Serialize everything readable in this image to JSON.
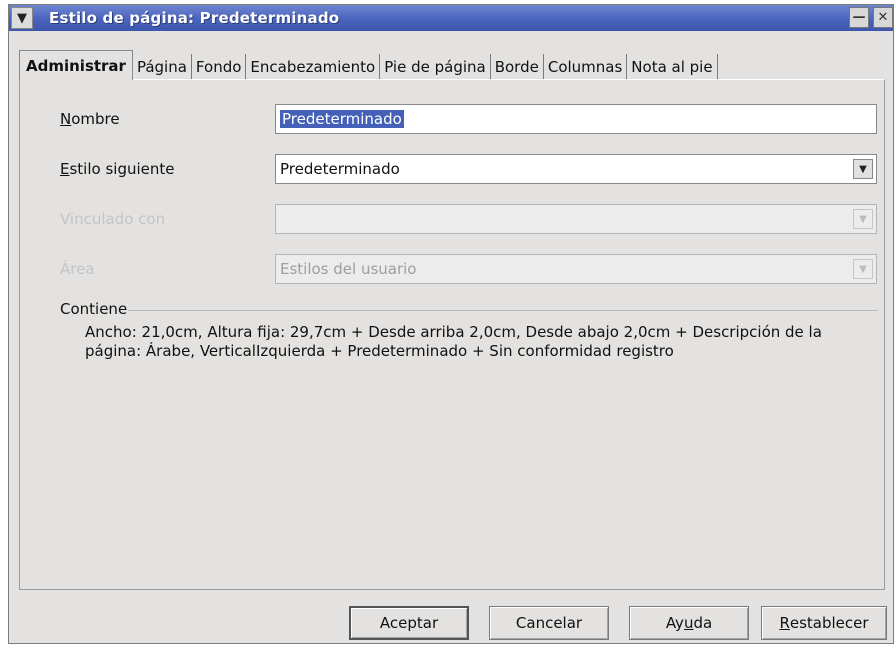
{
  "window": {
    "title": "Estilo de página: Predeterminado",
    "menu_icon": "chevron-down-icon",
    "minimize_icon": "minimize-icon",
    "close_icon": "close-icon"
  },
  "tabs": [
    {
      "label": "Administrar",
      "active": true
    },
    {
      "label": "Página",
      "active": false
    },
    {
      "label": "Fondo",
      "active": false
    },
    {
      "label": "Encabezamiento",
      "active": false
    },
    {
      "label": "Pie de página",
      "active": false
    },
    {
      "label": "Borde",
      "active": false
    },
    {
      "label": "Columnas",
      "active": false
    },
    {
      "label": "Nota al pie",
      "active": false
    }
  ],
  "fields": {
    "name": {
      "label_first": "N",
      "label_rest": "ombre",
      "value": "Predeterminado"
    },
    "next_style": {
      "label_first": "E",
      "label_rest": "stilo siguiente",
      "value": "Predeterminado"
    },
    "linked_with": {
      "label": "Vinculado con",
      "value": ""
    },
    "area": {
      "label": "Área",
      "value": "Estilos del usuario"
    }
  },
  "contains": {
    "label": "Contiene",
    "text": "Ancho: 21,0cm, Altura fija: 29,7cm + Desde arriba 2,0cm, Desde abajo 2,0cm + Descripción de la página:  Árabe, VerticalIzquierda + Predeterminado + Sin conformidad registro"
  },
  "buttons": {
    "ok": "Aceptar",
    "cancel": "Cancelar",
    "help_before": "Ay",
    "help_underlined": "u",
    "help_after": "da",
    "reset_first": "R",
    "reset_rest": "establecer"
  },
  "colors": {
    "titlebar": "#4a64bd",
    "selection": "#4560b8",
    "dialog_bg": "#e4e2e0"
  }
}
